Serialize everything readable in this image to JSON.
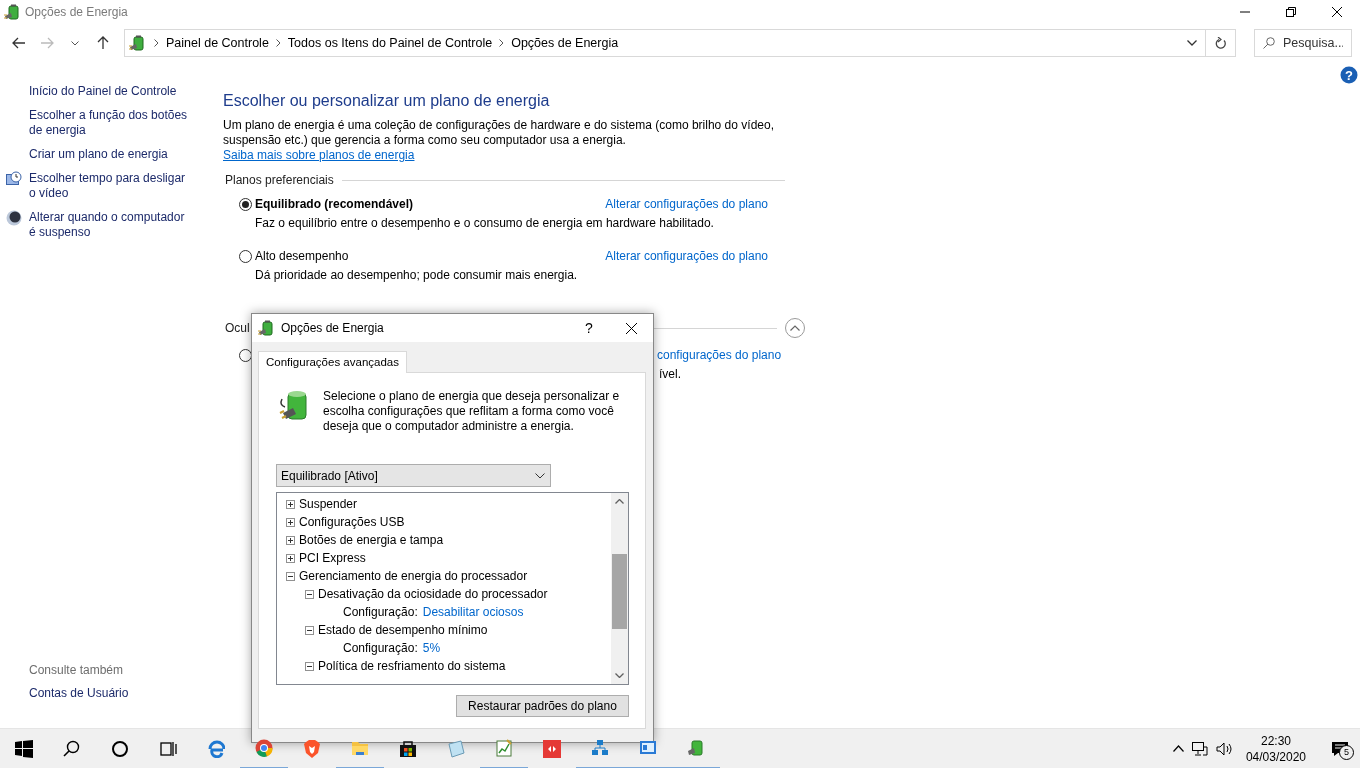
{
  "window": {
    "title": "Opções de Energia"
  },
  "address_bar": {
    "breadcrumbs": [
      "Painel de Controle",
      "Todos os Itens do Painel de Controle",
      "Opções de Energia"
    ],
    "search": {
      "placeholder": "Pesquisa..."
    }
  },
  "help_button": "?",
  "sidebar": {
    "items": [
      {
        "label": "Início do Painel de Controle"
      },
      {
        "label": "Escolher a função dos botões de energia"
      },
      {
        "label": "Criar um plano de energia"
      },
      {
        "label": "Escolher tempo para desligar o vídeo"
      },
      {
        "label": "Alterar quando o computador é suspenso"
      }
    ],
    "see_also": {
      "heading": "Consulte também",
      "items": [
        "Contas de Usuário"
      ]
    }
  },
  "content": {
    "heading": "Escolher ou personalizar um plano de energia",
    "intro": "Um plano de energia é uma coleção de configurações de hardware e do sistema (como brilho do vídeo, suspensão etc.) que gerencia a forma como seu computador usa a energia.",
    "intro_link": "Saiba mais sobre planos de energia",
    "preferred": {
      "heading": "Planos preferenciais",
      "plans": [
        {
          "name": "Equilibrado (recomendável)",
          "selected": true,
          "description": "Faz o equilíbrio entre o desempenho e o consumo de energia em hardware habilitado.",
          "link": "Alterar configurações do plano"
        },
        {
          "name": "Alto desempenho",
          "selected": false,
          "description": "Dá prioridade ao desempenho; pode consumir mais energia.",
          "link": "Alterar configurações do plano"
        }
      ]
    },
    "hidden_section": {
      "heading": "Ocul",
      "plan": {
        "selected": false,
        "description": "ível.",
        "link": "configurações do plano"
      }
    }
  },
  "dialog": {
    "title": "Opções de Energia",
    "help": "?",
    "tabs": [
      {
        "label": "Configurações avançadas",
        "selected": true
      }
    ],
    "description": "Selecione o plano de energia que deseja personalizar e escolha configurações que reflitam a forma como você deseja que o computador administre a energia.",
    "plan_select": "Equilibrado [Ativo]",
    "tree": [
      {
        "label": "Suspender",
        "expanded": false
      },
      {
        "label": "Configurações USB",
        "expanded": false
      },
      {
        "label": "Botões de energia e tampa",
        "expanded": false
      },
      {
        "label": "PCI Express",
        "expanded": false
      },
      {
        "label": "Gerenciamento de energia do processador",
        "expanded": true,
        "children": [
          {
            "label": "Desativação da ociosidade do processador",
            "expanded": true,
            "children": [
              {
                "kind": "setting",
                "label": "Configuração:",
                "value": "Desabilitar ociosos"
              }
            ]
          },
          {
            "label": "Estado de desempenho mínimo",
            "expanded": true,
            "children": [
              {
                "kind": "setting",
                "label": "Configuração:",
                "value": "5%"
              }
            ]
          },
          {
            "label": "Política de resfriamento do sistema",
            "expanded": true
          }
        ]
      }
    ],
    "restore_button": "Restaurar padrões do plano"
  },
  "taskbar": {
    "time": "22:30",
    "date": "04/03/2020",
    "notifications": "5"
  }
}
